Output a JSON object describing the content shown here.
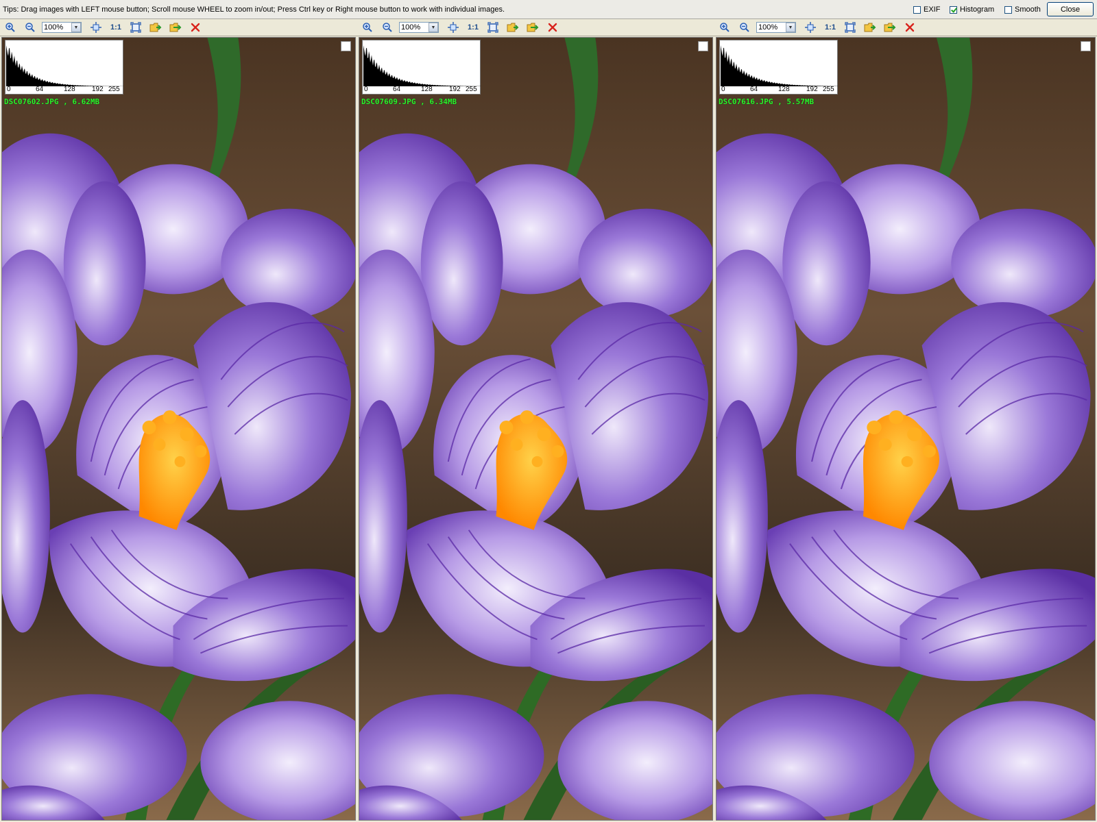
{
  "tips": "Tips: Drag images with LEFT mouse button; Scroll mouse WHEEL to zoom in/out; Press Ctrl key or Right mouse button to work with individual images.",
  "options": {
    "exif": {
      "label": "EXIF",
      "checked": false
    },
    "histogram": {
      "label": "Histogram",
      "checked": true
    },
    "smooth": {
      "label": "Smooth",
      "checked": false
    }
  },
  "close_label": "Close",
  "toolbar": {
    "zoom_value": "100%",
    "one_to_one": "1:1",
    "icons": [
      "zoom-in-icon",
      "zoom-out-icon",
      "fit-icon",
      "actual-size-icon",
      "fullscreen-icon",
      "open-icon",
      "export-icon",
      "remove-icon"
    ]
  },
  "histogram_ticks": [
    "0",
    "64",
    "128",
    "192",
    "255"
  ],
  "panes": [
    {
      "filename": "DSC07602.JPG",
      "size": "6.62MB"
    },
    {
      "filename": "DSC07609.JPG",
      "size": "6.34MB"
    },
    {
      "filename": "DSC07616.JPG",
      "size": "5.57MB"
    }
  ],
  "colors": {
    "info_text": "#2cf52c",
    "petal": "#7a4fc0",
    "stamen": "#ff9a00"
  }
}
